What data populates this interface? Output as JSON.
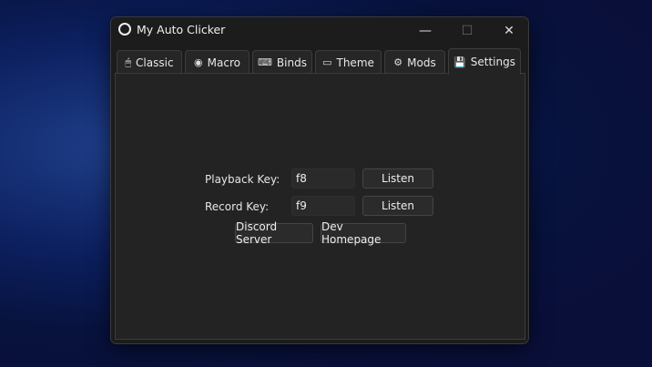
{
  "window": {
    "title": "My Auto Clicker",
    "minimize": "—",
    "maximize": "☐",
    "close": "✕"
  },
  "tabs": [
    {
      "label": "Classic",
      "icon": "mouse-icon",
      "glyph": "🖱"
    },
    {
      "label": "Macro",
      "icon": "record-icon",
      "glyph": "◉"
    },
    {
      "label": "Binds",
      "icon": "keyboard-icon",
      "glyph": "⌨"
    },
    {
      "label": "Theme",
      "icon": "laptop-icon",
      "glyph": "▭"
    },
    {
      "label": "Mods",
      "icon": "file-gear-icon",
      "glyph": "⚙"
    },
    {
      "label": "Settings",
      "icon": "save-icon",
      "glyph": "💾"
    }
  ],
  "active_tab": "Settings",
  "settings": {
    "playback_label": "Playback Key:",
    "playback_value": "f8",
    "playback_listen": "Listen",
    "record_label": "Record Key:",
    "record_value": "f9",
    "record_listen": "Listen",
    "discord": "Discord Server",
    "homepage": "Dev Homepage"
  }
}
